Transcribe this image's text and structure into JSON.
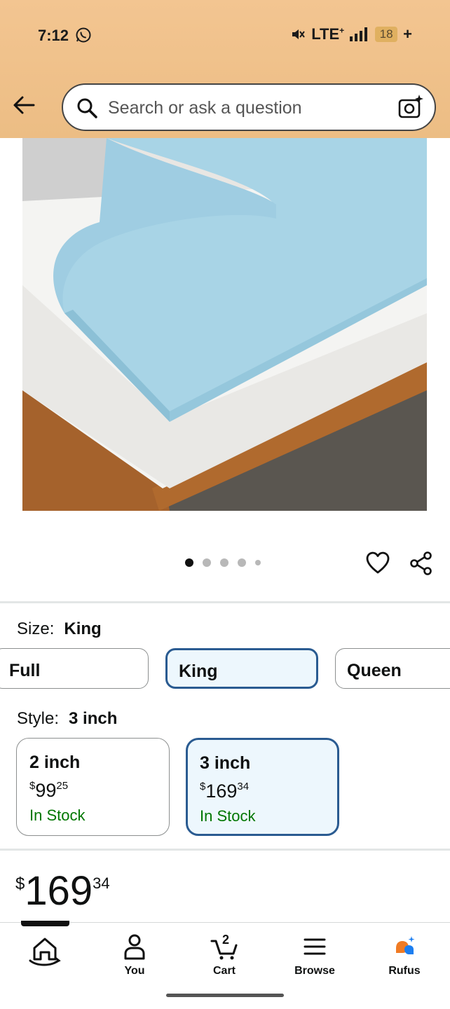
{
  "status_bar": {
    "time": "7:12",
    "network": "LTE",
    "network_sup": "+",
    "battery": "18",
    "charging": "+"
  },
  "header": {
    "search_placeholder": "Search or ask a question",
    "accent_color": "#ecbd84"
  },
  "gallery": {
    "image_subject": "blue gel memory foam mattress topper on a bed",
    "dot_count": 5,
    "active_index": 0
  },
  "size": {
    "label": "Size:",
    "selected": "King",
    "options": [
      "Full",
      "King",
      "Queen"
    ]
  },
  "style": {
    "label": "Style:",
    "selected": "3 inch",
    "options": [
      {
        "name": "2 inch",
        "currency": "$",
        "whole": "99",
        "cents": "25",
        "stock": "In Stock"
      },
      {
        "name": "3 inch",
        "currency": "$",
        "whole": "169",
        "cents": "34",
        "stock": "In Stock"
      }
    ]
  },
  "price": {
    "currency": "$",
    "whole": "169",
    "cents": "34"
  },
  "bottom_nav": {
    "items": [
      {
        "label": "",
        "icon": "home-icon"
      },
      {
        "label": "You",
        "icon": "person-icon"
      },
      {
        "label": "Cart",
        "icon": "cart-icon",
        "badge": "2"
      },
      {
        "label": "Browse",
        "icon": "menu-icon"
      },
      {
        "label": "Rufus",
        "icon": "rufus-icon"
      }
    ]
  }
}
